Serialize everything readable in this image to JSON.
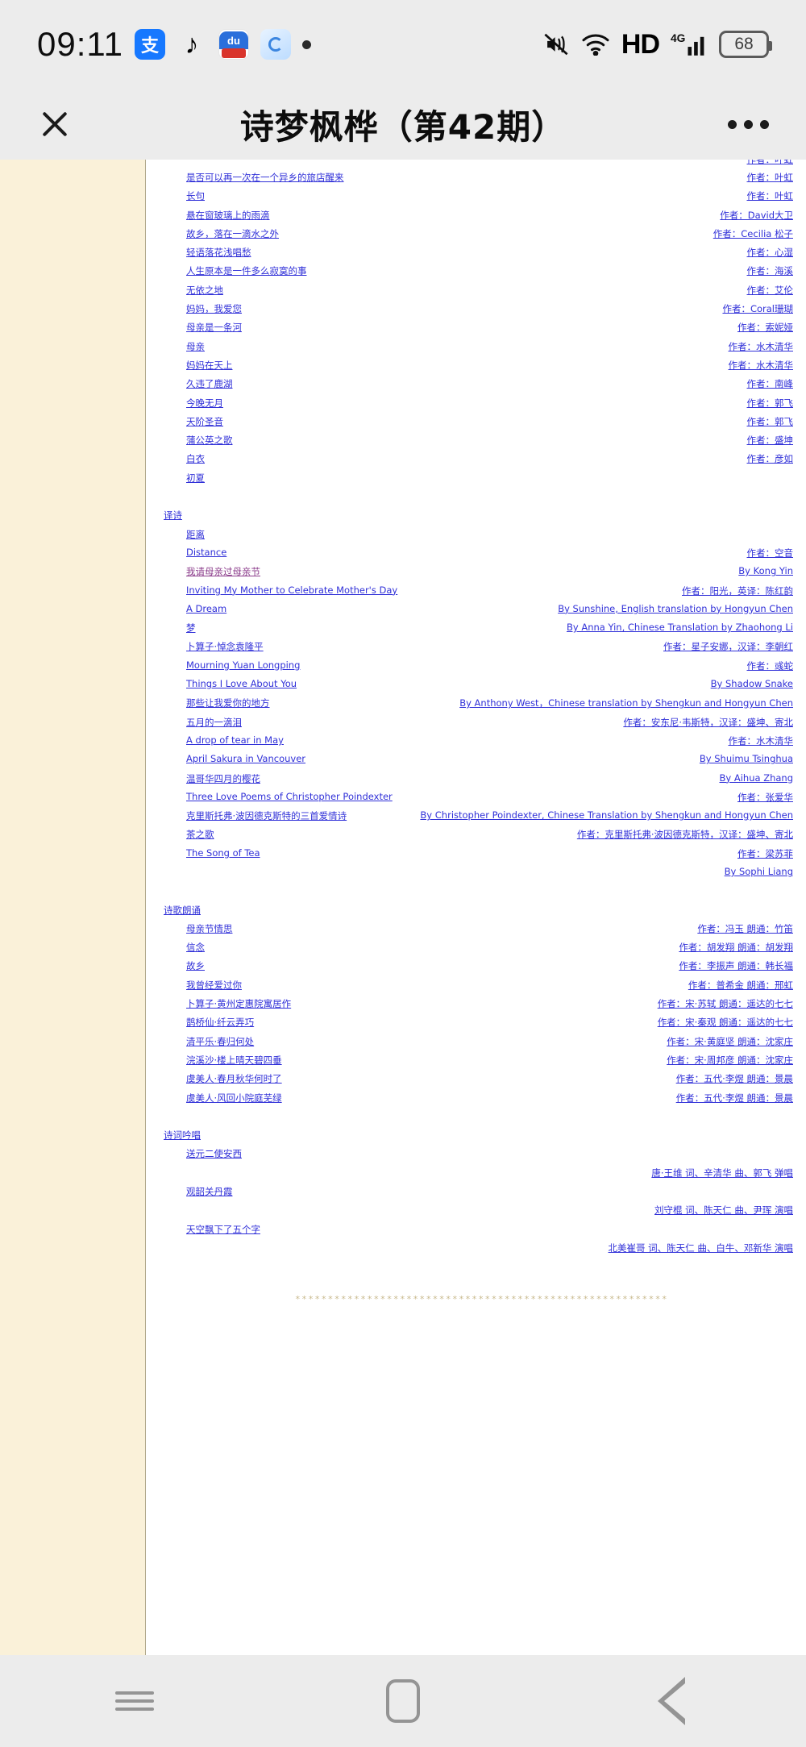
{
  "status_bar": {
    "time": "09:11",
    "app_icons": [
      "alipay-icon",
      "tiktok-icon",
      "baidu-icon",
      "quark-icon",
      "dot-icon"
    ],
    "alipay_glyph": "支",
    "baidu_glyph": "du",
    "hd_label": "HD",
    "network_label": "4G",
    "battery_level": "68",
    "right_icons": [
      "mute-icon",
      "wifi-icon",
      "hd-icon",
      "signal-icon",
      "battery-icon"
    ]
  },
  "title_bar": {
    "close_label": "close-icon",
    "title": "诗梦枫桦（第42期）",
    "more_label": "more-options-icon"
  },
  "content": {
    "partial_top_author": "作者：叶虹",
    "sections": [
      {
        "heading": null,
        "entries": [
          {
            "title": "是否可以再一次在一个异乡的旅店醒来",
            "author": "作者：叶虹"
          },
          {
            "title": "长句",
            "author": "作者：叶虹"
          },
          {
            "title": "悬在窗玻璃上的雨滴",
            "author": "作者：David大卫"
          },
          {
            "title": "故乡，落在一滴水之外",
            "author": "作者：Cecilia 松子"
          },
          {
            "title": "轻语落花浅唱愁",
            "author": "作者：心湿"
          },
          {
            "title": "人生原本是一件多么寂寞的事",
            "author": "作者：海溪"
          },
          {
            "title": "无依之地",
            "author": "作者：艾伦"
          },
          {
            "title": "妈妈，我爱您",
            "author": "作者：Coral珊瑚"
          },
          {
            "title": "母亲是一条河",
            "author": "作者：索妮娅"
          },
          {
            "title": "母亲",
            "author": "作者：水木清华"
          },
          {
            "title": "妈妈在天上",
            "author": "作者：水木清华"
          },
          {
            "title": "久违了鹿湖",
            "author": "作者：南峰"
          },
          {
            "title": "今晚无月",
            "author": "作者：郭飞"
          },
          {
            "title": "天阶圣音",
            "author": "作者：郭飞"
          },
          {
            "title": "蒲公英之歌",
            "author": "作者：盛坤"
          },
          {
            "title": "白衣",
            "author": "作者：彦如"
          },
          {
            "title": "初夏",
            "author": ""
          }
        ]
      },
      {
        "heading": "译诗",
        "entries": [
          {
            "title": "距离",
            "author": ""
          },
          {
            "title": "Distance",
            "author": "作者：空音"
          },
          {
            "title": "我请母亲过母亲节",
            "author": "By Kong Yin",
            "visited": true
          },
          {
            "title": "Inviting My Mother to Celebrate Mother's Day",
            "author": "作者：阳光，英译：陈红韵"
          },
          {
            "title": "A Dream",
            "author": "By Sunshine, English translation by Hongyun Chen"
          },
          {
            "title": "梦",
            "author": "By Anna Yin, Chinese Translation by Zhaohong Li"
          },
          {
            "title": "卜算子·悼念袁隆平",
            "author": "作者：星子安娜，汉译：李朝红"
          },
          {
            "title": "Mourning Yuan Longping",
            "author": "作者：彧蛇"
          },
          {
            "title": "Things I Love About You",
            "author": "By Shadow Snake"
          },
          {
            "title": "那些让我爱你的地方",
            "author": "By Anthony West，Chinese translation by Shengkun and Hongyun Chen"
          },
          {
            "title": "五月的一滴泪",
            "author": "作者：安东尼·韦斯特，汉译：盛坤、寄北"
          },
          {
            "title": "A drop of tear in May",
            "author": "作者：水木清华"
          },
          {
            "title": "April Sakura in Vancouver",
            "author": "By Shuimu Tsinghua"
          },
          {
            "title": "温哥华四月的樱花",
            "author": "By Aihua Zhang"
          },
          {
            "title": "Three Love Poems of Christopher Poindexter",
            "author": "作者：张爱华"
          },
          {
            "title": "克里斯托弗·波因德克斯特的三首爱情诗",
            "author": "By Christopher Poindexter, Chinese Translation by Shengkun and Hongyun Chen"
          },
          {
            "title": "茶之歌",
            "author": "作者：克里斯托弗·波因德克斯特，汉译：盛坤、寄北"
          },
          {
            "title": "The Song of Tea",
            "author": "作者：梁苏菲"
          },
          {
            "title": "",
            "author": "By Sophi Liang"
          }
        ]
      },
      {
        "heading": "诗歌朗诵",
        "entries": [
          {
            "title": "母亲节情思",
            "author": "作者：冯玉  朗通：竹笛"
          },
          {
            "title": "信念",
            "author": "作者：胡发翔  朗通：胡发翔"
          },
          {
            "title": "故乡",
            "author": "作者：李振声  朗通：韩长福"
          },
          {
            "title": "我曾经爱过你",
            "author": "作者：普希金 朗通：邢虹"
          },
          {
            "title": "卜算子·黄州定惠院寓居作",
            "author": "作者：宋·苏轼  朗通：遥达的七七"
          },
          {
            "title": "鹊桥仙·纤云弄巧",
            "author": "作者：宋·秦观  朗通：遥达的七七"
          },
          {
            "title": "清平乐·春归何处",
            "author": "作者：宋·黄庭坚  朗通：沈家庄"
          },
          {
            "title": "浣溪沙·楼上晴天碧四垂",
            "author": "作者：宋·周邦彦  朗通：沈家庄"
          },
          {
            "title": "虞美人·春月秋华何时了",
            "author": "作者：五代·李煜  朗通：景晨"
          },
          {
            "title": "虞美人·风回小院庭芜绿",
            "author": "作者：五代·李煜  朗通：景晨"
          }
        ]
      },
      {
        "heading": "诗词吟唱",
        "entries": [
          {
            "title": "送元二使安西",
            "author": ""
          },
          {
            "title": "",
            "author": "唐·王维 词、辛清华 曲、郭飞 弹唱"
          },
          {
            "title": "观韶关丹霞",
            "author": ""
          },
          {
            "title": "",
            "author": "刘守棍 词、陈天仁 曲、尹珲 演唱"
          },
          {
            "title": "天空飘下了五个字",
            "author": ""
          },
          {
            "title": "",
            "author": "北美崔哥 词、陈天仁 曲、白牛、邓新华 演唱"
          }
        ]
      }
    ],
    "divider": "*********************************************************"
  },
  "nav_bar": {
    "items": [
      "menu-icon",
      "home-icon",
      "back-icon"
    ]
  },
  "colors": {
    "link": "#3030d8",
    "visited_link": "#8a3a8a",
    "paper": "#faf1d9",
    "sheet": "#ffffff",
    "chrome": "#ececec",
    "divider": "#c9ba8e"
  }
}
